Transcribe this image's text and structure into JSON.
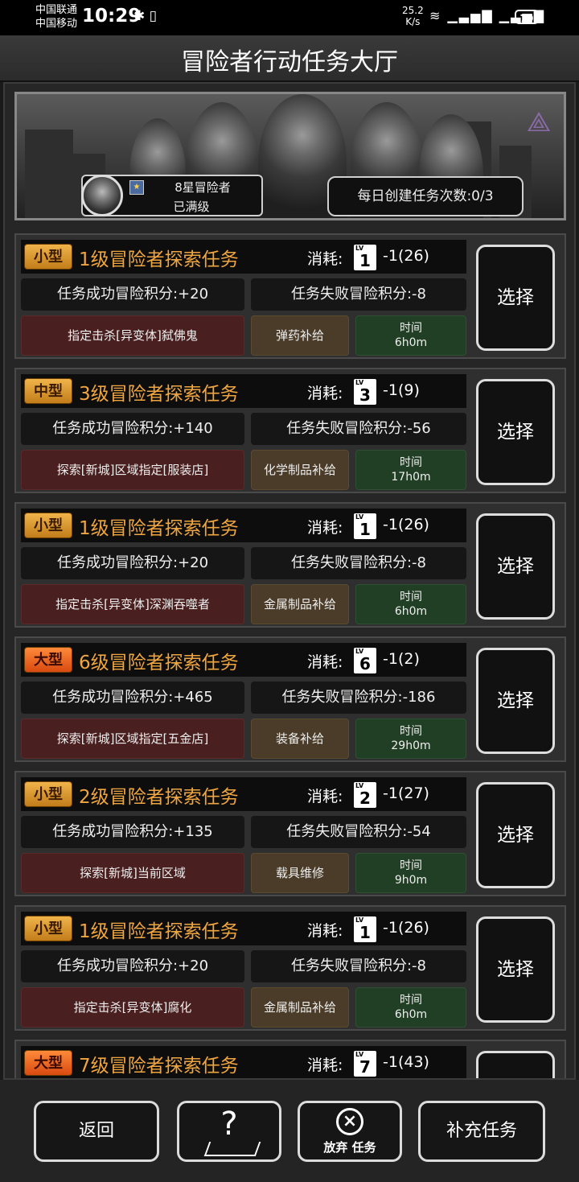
{
  "status": {
    "carrier1": "中国联通",
    "carrier2": "中国移动",
    "time": "10:29",
    "speed_value": "25.2",
    "speed_unit": "K/s",
    "battery": "70"
  },
  "page_title": "冒险者行动任务大厅",
  "profile": {
    "rank_name": "8星冒险者",
    "level_status": "已满级",
    "daily_text": "每日创建任务次数:0/3"
  },
  "tasks": [
    {
      "size": "小型",
      "name": "1级冒险者探索任务",
      "cost_label": "消耗:",
      "lv_tag": "LV",
      "lv": "1",
      "cost": "-1(26)",
      "success": "任务成功冒险积分:+20",
      "fail": "任务失败冒险积分:-8",
      "target": "指定击杀[异变体]弑佛鬼",
      "supply": "弹药补给",
      "time_label": "时间",
      "time_value": "6h0m",
      "select": "选择"
    },
    {
      "size": "中型",
      "name": "3级冒险者探索任务",
      "cost_label": "消耗:",
      "lv_tag": "LV",
      "lv": "3",
      "cost": "-1(9)",
      "success": "任务成功冒险积分:+140",
      "fail": "任务失败冒险积分:-56",
      "target": "探索[新城]区域指定[服装店]",
      "supply": "化学制品补给",
      "time_label": "时间",
      "time_value": "17h0m",
      "select": "选择"
    },
    {
      "size": "小型",
      "name": "1级冒险者探索任务",
      "cost_label": "消耗:",
      "lv_tag": "LV",
      "lv": "1",
      "cost": "-1(26)",
      "success": "任务成功冒险积分:+20",
      "fail": "任务失败冒险积分:-8",
      "target": "指定击杀[异变体]深渊吞噬者",
      "supply": "金属制品补给",
      "time_label": "时间",
      "time_value": "6h0m",
      "select": "选择"
    },
    {
      "size": "大型",
      "name": "6级冒险者探索任务",
      "cost_label": "消耗:",
      "lv_tag": "LV",
      "lv": "6",
      "cost": "-1(2)",
      "success": "任务成功冒险积分:+465",
      "fail": "任务失败冒险积分:-186",
      "target": "探索[新城]区域指定[五金店]",
      "supply": "装备补给",
      "time_label": "时间",
      "time_value": "29h0m",
      "select": "选择"
    },
    {
      "size": "小型",
      "name": "2级冒险者探索任务",
      "cost_label": "消耗:",
      "lv_tag": "LV",
      "lv": "2",
      "cost": "-1(27)",
      "success": "任务成功冒险积分:+135",
      "fail": "任务失败冒险积分:-54",
      "target": "探索[新城]当前区域",
      "supply": "载具维修",
      "time_label": "时间",
      "time_value": "9h0m",
      "select": "选择"
    },
    {
      "size": "小型",
      "name": "1级冒险者探索任务",
      "cost_label": "消耗:",
      "lv_tag": "LV",
      "lv": "1",
      "cost": "-1(26)",
      "success": "任务成功冒险积分:+20",
      "fail": "任务失败冒险积分:-8",
      "target": "指定击杀[异变体]腐化",
      "supply": "金属制品补给",
      "time_label": "时间",
      "time_value": "6h0m",
      "select": "选择"
    },
    {
      "size": "大型",
      "name": "7级冒险者探索任务",
      "cost_label": "消耗:",
      "lv_tag": "LV",
      "lv": "7",
      "cost": "-1(43)",
      "success": "",
      "fail": "",
      "target": "",
      "supply": "",
      "time_label": "",
      "time_value": "",
      "select": ""
    }
  ],
  "bottom": {
    "back": "返回",
    "abandon": "放弃 任务",
    "replenish": "补充任务"
  },
  "icons": {
    "help": "question-map-icon",
    "abandon": "x-circle-icon",
    "emblem": "triangle-emblem-icon"
  }
}
